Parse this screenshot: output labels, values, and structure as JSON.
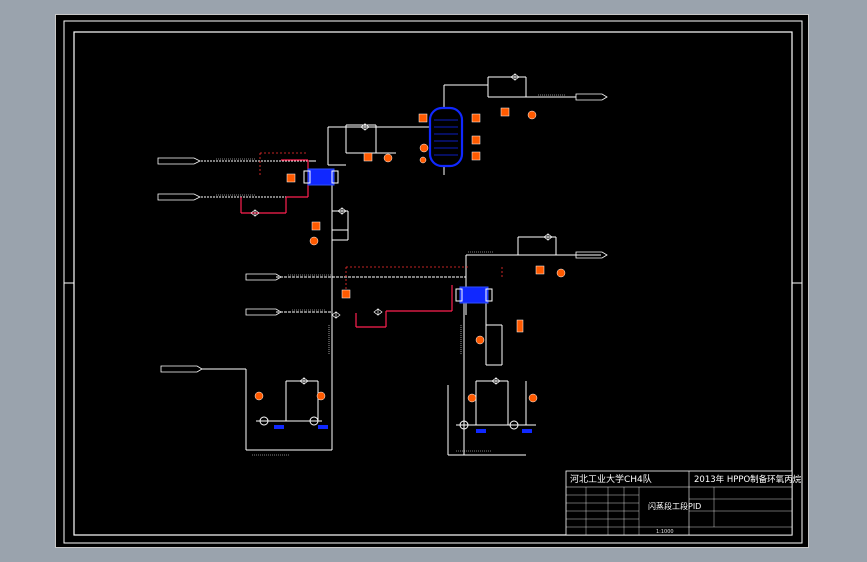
{
  "title_block": {
    "school": "河北工业大学CH4队",
    "project": "2013年 HPPO制备环氧丙烷",
    "drawing_name": "闪蒸段工段PID",
    "scale": "1:1000"
  },
  "colors": {
    "background": "#000000",
    "frame": "#ffffff",
    "process_line": "#ffffff",
    "utility_line": "#ff2050",
    "signal_line": "#ff3030",
    "equipment": "#1028ff",
    "instrument": "#ff5a00"
  },
  "equipment": [
    {
      "name": "flash-column",
      "shape": "column"
    },
    {
      "name": "condenser-1",
      "shape": "exchanger"
    },
    {
      "name": "condenser-2",
      "shape": "exchanger"
    },
    {
      "name": "pump-1a",
      "shape": "pump"
    },
    {
      "name": "pump-1b",
      "shape": "pump"
    },
    {
      "name": "pump-2a",
      "shape": "pump"
    },
    {
      "name": "pump-2b",
      "shape": "pump"
    }
  ]
}
